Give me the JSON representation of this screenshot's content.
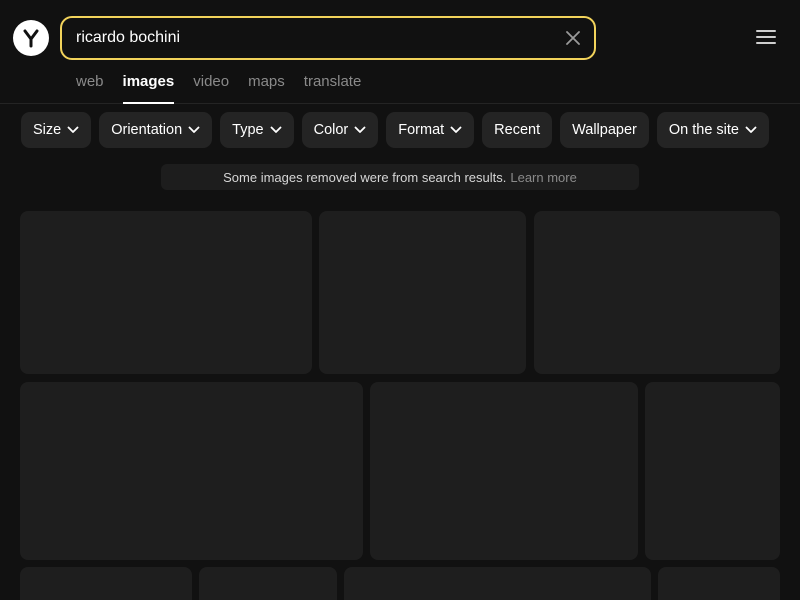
{
  "search": {
    "query": "ricardo bochini"
  },
  "tabs": [
    {
      "label": "web",
      "active": false
    },
    {
      "label": "images",
      "active": true
    },
    {
      "label": "video",
      "active": false
    },
    {
      "label": "maps",
      "active": false
    },
    {
      "label": "translate",
      "active": false
    }
  ],
  "filters": [
    {
      "label": "Size",
      "dropdown": true
    },
    {
      "label": "Orientation",
      "dropdown": true
    },
    {
      "label": "Type",
      "dropdown": true
    },
    {
      "label": "Color",
      "dropdown": true
    },
    {
      "label": "Format",
      "dropdown": true
    },
    {
      "label": "Recent",
      "dropdown": false
    },
    {
      "label": "Wallpaper",
      "dropdown": false
    },
    {
      "label": "On the site",
      "dropdown": true
    }
  ],
  "notice": {
    "text": "Some images removed were from search results.",
    "link": "Learn more"
  },
  "colors": {
    "background": "#111111",
    "search_border": "#f2d35b",
    "chip": "#242424",
    "tile": "#1e1e1e"
  },
  "icons": {
    "logo": "yandex-logo-icon",
    "clear": "close-icon",
    "menu": "hamburger-menu-icon",
    "dropdown": "chevron-down-icon"
  }
}
